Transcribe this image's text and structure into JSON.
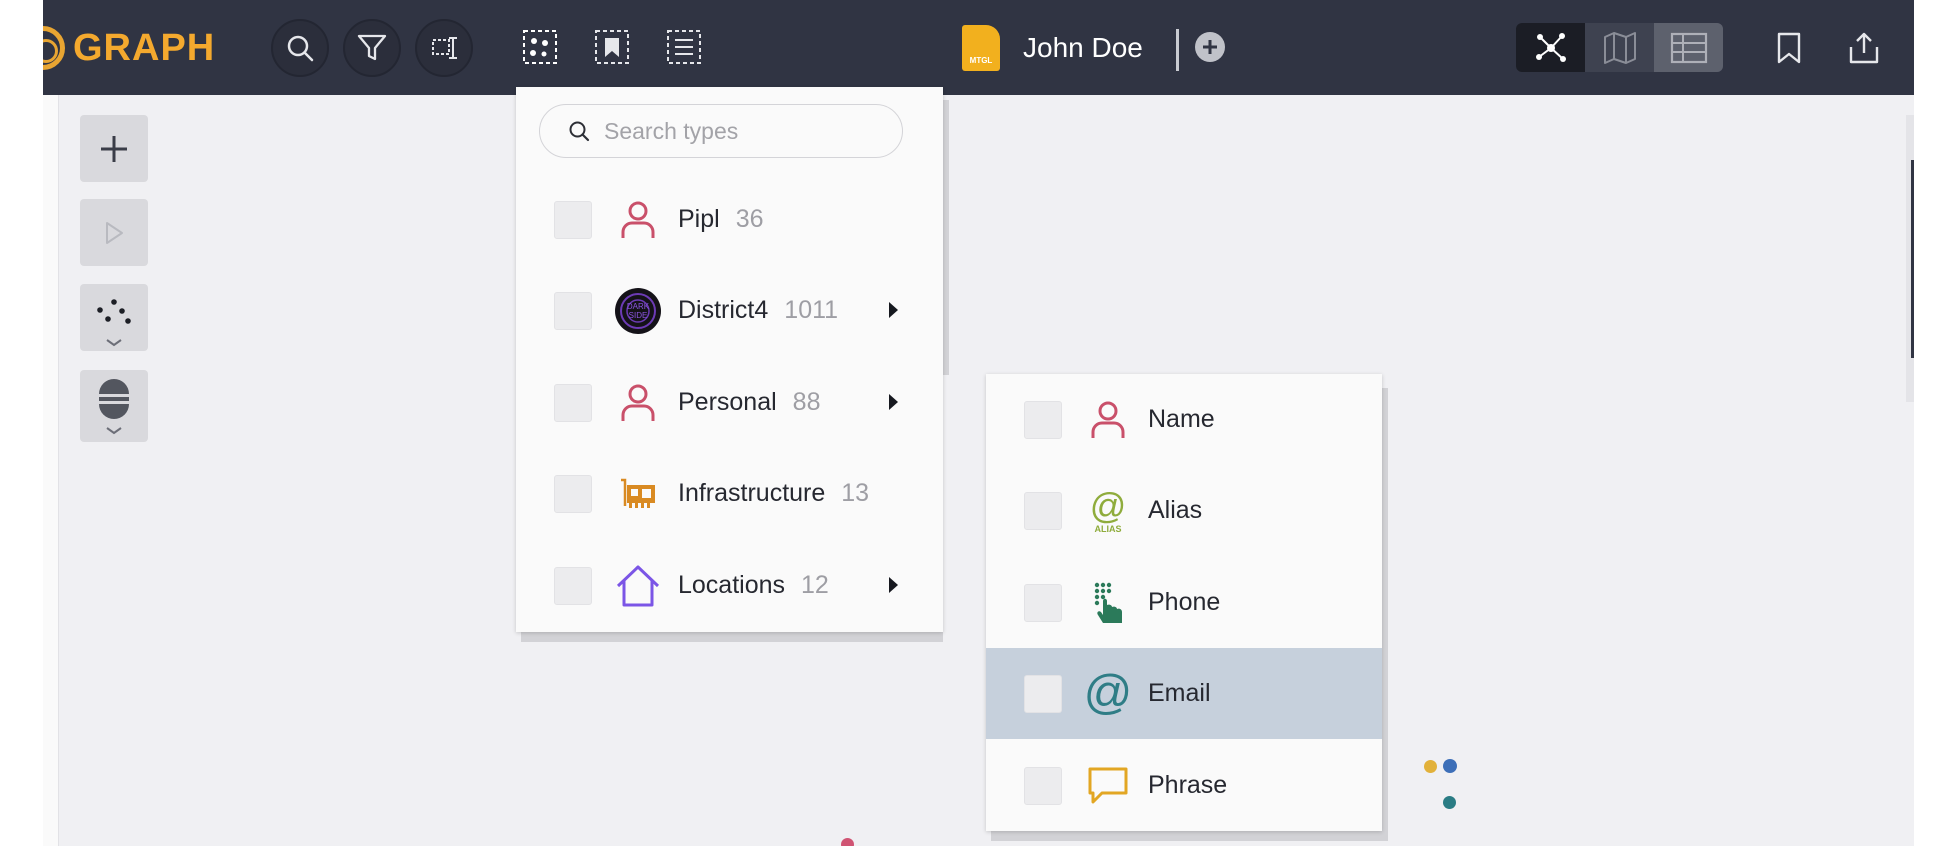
{
  "app": {
    "logo_text": "GRAPH",
    "document_badge": "MTGL",
    "document_title": "John Doe"
  },
  "toolbar": {
    "left_buttons": [
      "search-icon",
      "filter-icon",
      "layout-select-icon"
    ],
    "select_buttons": [
      "select-all-icon",
      "select-bookmarked-icon",
      "select-list-icon"
    ],
    "view_modes": [
      "graph-view-icon",
      "map-view-icon",
      "table-view-icon"
    ],
    "active_view": "graph",
    "right_buttons": [
      "bookmark-icon",
      "share-icon"
    ]
  },
  "side_tools": [
    "plus-icon",
    "play-icon",
    "scatter-layout-icon",
    "node-style-icon"
  ],
  "type_menu": {
    "search_placeholder": "Search types",
    "items": [
      {
        "label": "Pipl",
        "count": "36",
        "icon": "person-icon",
        "has_submenu": false
      },
      {
        "label": "District4",
        "count": "1011",
        "icon": "darkside-logo-icon",
        "has_submenu": true
      },
      {
        "label": "Personal",
        "count": "88",
        "icon": "person-icon",
        "has_submenu": true
      },
      {
        "label": "Infrastructure",
        "count": "13",
        "icon": "network-card-icon",
        "has_submenu": false
      },
      {
        "label": "Locations",
        "count": "12",
        "icon": "house-icon",
        "has_submenu": true
      }
    ]
  },
  "personal_submenu": {
    "items": [
      {
        "label": "Name",
        "icon": "person-icon"
      },
      {
        "label": "Alias",
        "icon": "alias-icon",
        "icon_text": "ALIAS"
      },
      {
        "label": "Phone",
        "icon": "phone-keypad-icon"
      },
      {
        "label": "Email",
        "icon": "at-sign-icon"
      },
      {
        "label": "Phrase",
        "icon": "speech-bubble-icon"
      }
    ],
    "highlighted": "Email"
  },
  "colors": {
    "topbar": "#303443",
    "brand": "#f4a92e",
    "person_icon": "#c9506a",
    "house_icon": "#7b55e6",
    "highlight_row": "#c6d0dc"
  }
}
